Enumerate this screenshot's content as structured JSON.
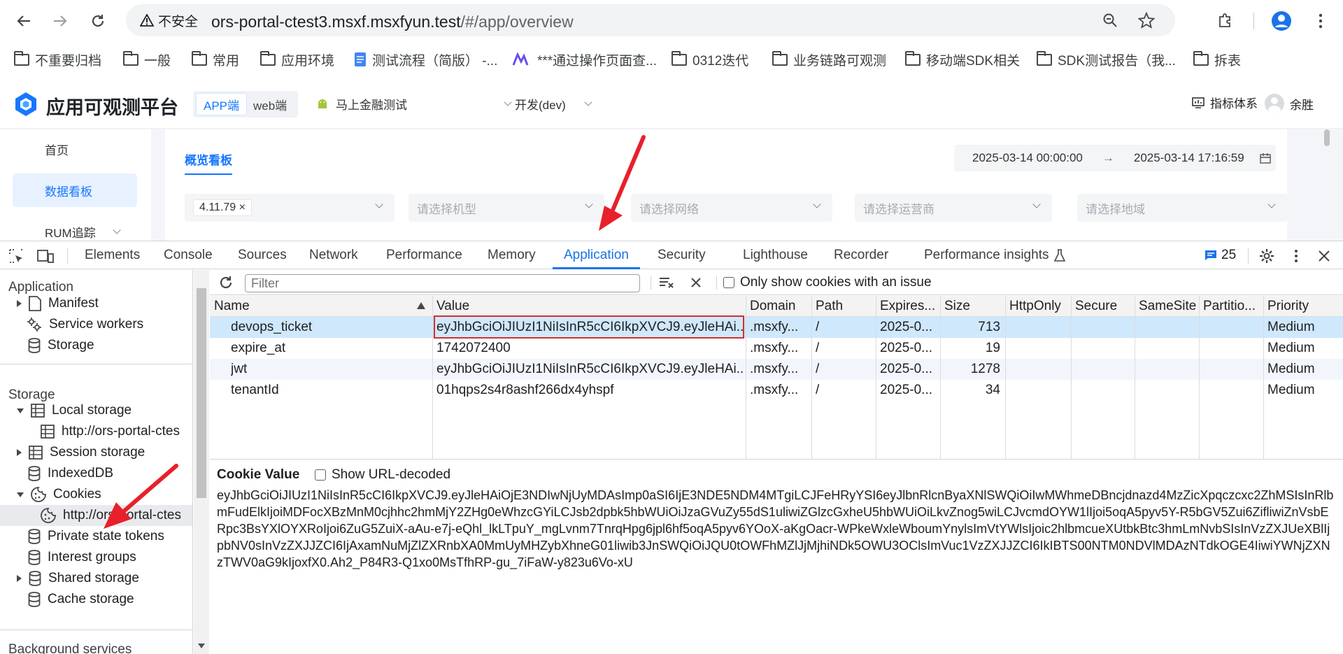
{
  "browser": {
    "security_label": "不安全",
    "url_host": "ors-portal-ctest3.msxf.msxfyun.test",
    "url_path": "/#/app/overview",
    "bookmarks": [
      "不重要归档",
      "一般",
      "常用",
      "应用环境",
      "测试流程（简版） -...",
      "***通过操作页面查...",
      "0312迭代",
      "业务链路可观测",
      "移动端SDK相关",
      "SDK测试报告（我...",
      "拆表"
    ]
  },
  "app": {
    "title": "应用可观测平台",
    "seg_app": "APP端",
    "seg_web": "web端",
    "app_select": "马上金融测试",
    "env_select": "开发(dev)",
    "metrics_link": "指标体系",
    "user_name": "余胜",
    "side": [
      "首页",
      "数据看板",
      "RUM追踪"
    ],
    "tab": "概览看板",
    "date_start": "2025-03-14 00:00:00",
    "date_end": "2025-03-14 17:16:59",
    "version_tag": "4.11.79",
    "filters": [
      "请选择机型",
      "请选择网络",
      "请选择运营商",
      "请选择地域"
    ]
  },
  "devtools": {
    "tabs": [
      "Elements",
      "Console",
      "Sources",
      "Network",
      "Performance",
      "Memory",
      "Application",
      "Security",
      "Lighthouse",
      "Recorder",
      "Performance insights"
    ],
    "issues_count": "25",
    "sidebar": {
      "application_header": "Application",
      "application_items": [
        "Manifest",
        "Service workers",
        "Storage"
      ],
      "storage_header": "Storage",
      "local_storage": "Local storage",
      "local_storage_child": "http://ors-portal-ctes",
      "session_storage": "Session storage",
      "indexeddb": "IndexedDB",
      "cookies": "Cookies",
      "cookies_child": "http://ors-portal-ctes",
      "private_state_tokens": "Private state tokens",
      "interest_groups": "Interest groups",
      "shared_storage": "Shared storage",
      "cache_storage": "Cache storage",
      "background_header": "Background services"
    },
    "filter_placeholder": "Filter",
    "only_issue_label": "Only show cookies with an issue",
    "columns": [
      "Name",
      "Value",
      "Domain",
      "Path",
      "Expires...",
      "Size",
      "HttpOnly",
      "Secure",
      "SameSite",
      "Partitio...",
      "Priority"
    ],
    "rows": [
      {
        "name": "devops_ticket",
        "value": "eyJhbGciOiJIUzI1NiIsInR5cCI6IkpXVCJ9.eyJleHAi...",
        "domain": ".msxfy...",
        "path": "/",
        "expires": "2025-0...",
        "size": "713",
        "priority": "Medium"
      },
      {
        "name": "expire_at",
        "value": "1742072400",
        "domain": ".msxfy...",
        "path": "/",
        "expires": "2025-0...",
        "size": "19",
        "priority": "Medium"
      },
      {
        "name": "jwt",
        "value": "eyJhbGciOiJIUzI1NiIsInR5cCI6IkpXVCJ9.eyJleHAi...",
        "domain": ".msxfy...",
        "path": "/",
        "expires": "2025-0...",
        "size": "1278",
        "priority": "Medium"
      },
      {
        "name": "tenantId",
        "value": "01hqps2s4r8ashf266dx4yhspf",
        "domain": ".msxfy...",
        "path": "/",
        "expires": "2025-0...",
        "size": "34",
        "priority": "Medium"
      }
    ],
    "cookie_value_label": "Cookie Value",
    "show_decoded_label": "Show URL-decoded",
    "cookie_value": "eyJhbGciOiJIUzI1NiIsInR5cCI6IkpXVCJ9.eyJleHAiOjE3NDIwNjUyMDAsImp0aSI6IjE3NDE5NDM4MTgiLCJFeHRyYSI6eyJlbnRlcnByaXNlSWQiOiIwMWhmeDBncjdnazd4MzZicXpqczcxc2ZhMSIsInRlbmFudElkIjoiMDFocXBzMnM0cjhhc2hmMjY2ZHg0eWhzcGYiLCJsb2dpbk5hbWUiOiJzaGVuZy55dS1uliwiZGlzcGxheU5hbWUiOiLkvZnog5wiLCJvcmdOYW1lIjoi5oqA5pyv5Y-R5bGV5Zui6ZifliwiZnVsbERpc3BsYXlOYXRoIjoi6ZuG5ZuiX-aAu-e7j-eQhl_lkLTpuY_mgLvnm7TnrqHpg6jpl6hf5oqA5pyv6YOoX-aKgOacr-WPkeWxleWboumYnylsImVtYWlsIjoic2hlbmcueXUtbkBtc3hmLmNvbSIsInVzZXJUeXBlIjpbNV0sInVzZXJJZCI6IjAxamNuMjZlZXRnbXA0MmUyMHZybXhneG01liwib3JnSWQiOiJQU0tOWFhMZlJjMjhiNDk5OWU3OClsImVuc1VzZXJJZCI6IkIBTS00NTM0NDVlMDAzNTdkOGE4IiwiYWNjZXNzTWV0aG9kIjoxfX0.Ah2_P84R3-Q1xo0MsTfhRP-gu_7iFaW-y823u6Vo-xU"
  }
}
